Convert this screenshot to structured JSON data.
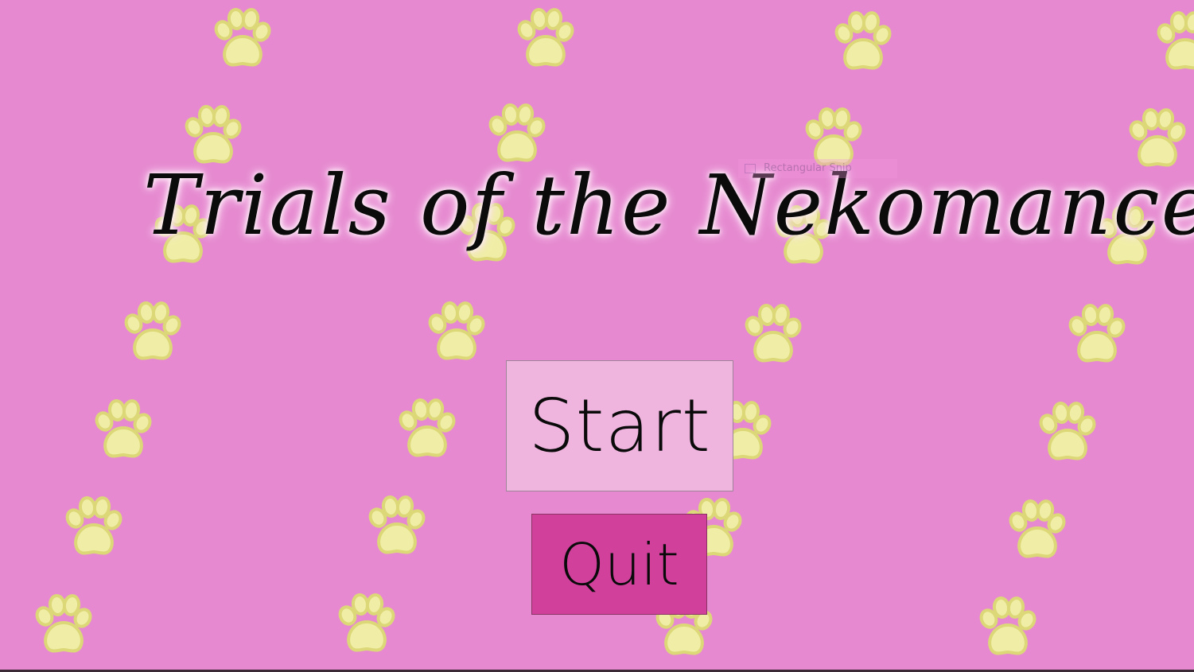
{
  "game": {
    "title": "Trials of the Nekomancer",
    "buttons": {
      "start": "Start",
      "quit": "Quit"
    }
  },
  "overlay": {
    "snip_tooltip": "Rectangular Snip"
  },
  "colors": {
    "background": "#e689d0",
    "paw_fill": "#f0eea6",
    "paw_outline": "#dcd878",
    "start_button": "#efb5df",
    "quit_button": "#d1419c"
  },
  "decorations": {
    "paw_icon": "paw-print-icon"
  }
}
